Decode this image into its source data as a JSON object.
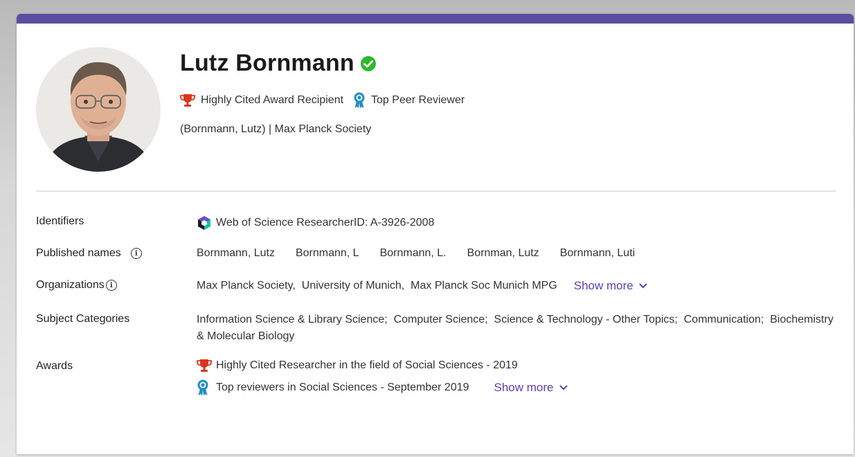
{
  "profile": {
    "name": "Lutz Bornmann",
    "badges": [
      {
        "icon": "trophy-icon",
        "label": "Highly Cited Award Recipient"
      },
      {
        "icon": "reviewer-ribbon-icon",
        "label": "Top Peer Reviewer"
      }
    ],
    "affiliation": "(Bornmann, Lutz) | Max Planck Society"
  },
  "details": {
    "identifiers": {
      "label": "Identifiers",
      "value": "Web of Science ResearcherID: A-3926-2008"
    },
    "published_names": {
      "label": "Published names",
      "items": [
        "Bornmann, Lutz",
        "Bornmann, L",
        "Bornmann, L.",
        "Bornman, Lutz",
        "Bornmann, Luti"
      ]
    },
    "organizations": {
      "label": "Organizations",
      "value": "Max Planck Society,  University of Munich,  Max Planck Soc Munich MPG",
      "show_more": "Show more"
    },
    "subject_categories": {
      "label": "Subject Categories",
      "value": "Information Science & Library Science;  Computer Science;  Science & Technology - Other Topics;  Communication;  Biochemistry & Molecular Biology"
    },
    "awards": {
      "label": "Awards",
      "items": [
        {
          "icon": "trophy-icon",
          "text": "Highly Cited Researcher in the field of Social Sciences - 2019"
        },
        {
          "icon": "reviewer-ribbon-icon",
          "text": "Top reviewers in Social Sciences - September 2019"
        }
      ],
      "show_more": "Show more"
    }
  },
  "colors": {
    "accent_bar": "#5b4da0",
    "link": "#5b3fb8",
    "verified": "#2eb82e",
    "trophy": "#d9361e",
    "reviewer": "#1d8ec4"
  }
}
